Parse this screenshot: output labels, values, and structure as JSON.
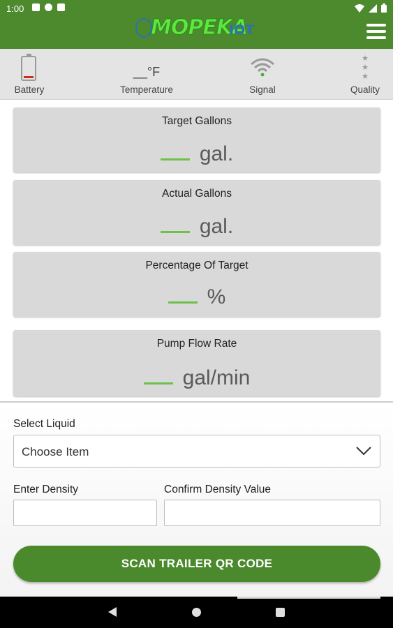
{
  "status_bar": {
    "time": "1:00"
  },
  "app_bar": {
    "logo_text": "MOPEKA",
    "logo_suffix": "IOT"
  },
  "indicators": [
    {
      "label": "Battery",
      "icon": "battery-low-icon",
      "level": 0.1
    },
    {
      "label": "Temperature",
      "value": "__°F"
    },
    {
      "label": "Signal",
      "icon": "wifi-signal-icon"
    },
    {
      "label": "Quality",
      "icon": "stars-icon"
    }
  ],
  "metrics": [
    {
      "title": "Target Gallons",
      "unit": "gal."
    },
    {
      "title": "Actual Gallons",
      "unit": "gal."
    },
    {
      "title": "Percentage Of Target",
      "unit": "%"
    },
    {
      "title": "Pump Flow Rate",
      "unit": "gal/min"
    }
  ],
  "form": {
    "select_liquid_label": "Select Liquid",
    "select_value": "Choose Item",
    "enter_density_label": "Enter Density",
    "confirm_density_label": "Confirm Density Value",
    "density_value": "",
    "confirm_density_value": "",
    "scan_button": "SCAN TRAILER QR CODE"
  },
  "colors": {
    "app_bar": "#4d8a2e",
    "accent_dash": "#6dc04a",
    "battery_low": "#d52b1e",
    "button": "#4a8a2c"
  }
}
